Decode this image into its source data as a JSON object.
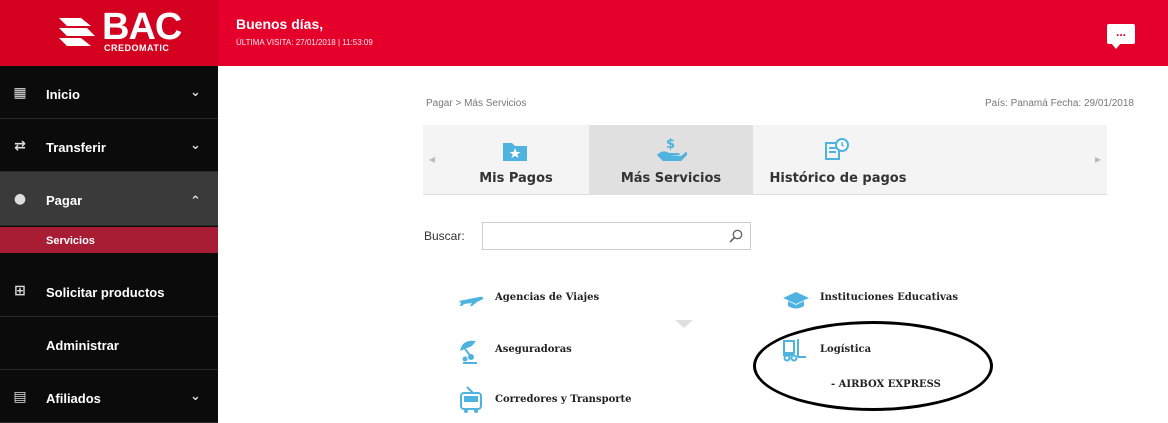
{
  "header": {
    "logo_text": "BAC",
    "logo_sub": "CREDOMATIC",
    "greeting": "Buenos días,",
    "last_visit": "ÚLTIMA VISITA: 27/01/2018 | 11:53:09",
    "chat_icon": "chat-bubble-icon",
    "brand_color": "#e4002b"
  },
  "sidebar": {
    "items": [
      {
        "label": "Inicio",
        "icon": "grid-icon",
        "chevron": "chevron-down-icon"
      },
      {
        "label": "Transferir",
        "icon": "transfer-icon",
        "chevron": "chevron-down-icon"
      },
      {
        "label": "Pagar",
        "icon": "moneybag-icon",
        "chevron": "chevron-up-icon"
      },
      {
        "label": "Solicitar productos",
        "icon": "plus-box-icon"
      },
      {
        "label": "Administrar"
      },
      {
        "label": "Afiliados",
        "icon": "building-icon",
        "chevron": "chevron-down-icon"
      }
    ],
    "sub_item": "Servicios"
  },
  "breadcrumb": "Pagar > Más Servicios",
  "country_date": "País: Panamá   Fecha: 29/01/2018",
  "tabs": [
    {
      "label": "Mis Pagos",
      "icon": "star-folder-icon"
    },
    {
      "label": "Más Servicios",
      "icon": "hand-money-icon",
      "active": true
    },
    {
      "label": "Histórico de pagos",
      "icon": "history-doc-icon"
    }
  ],
  "search": {
    "label": "Buscar:",
    "value": "",
    "placeholder": ""
  },
  "categories": [
    {
      "label": "Agencias de Viajes",
      "icon": "airplane-icon"
    },
    {
      "label": "Instituciones Educativas",
      "icon": "graduation-cap-icon"
    },
    {
      "label": "Aseguradoras",
      "icon": "umbrella-icon"
    },
    {
      "label": "Logística",
      "icon": "forklift-icon"
    },
    {
      "label": "Corredores y Transporte",
      "icon": "bus-icon"
    }
  ],
  "subcategory": "- AIRBOX EXPRESS"
}
